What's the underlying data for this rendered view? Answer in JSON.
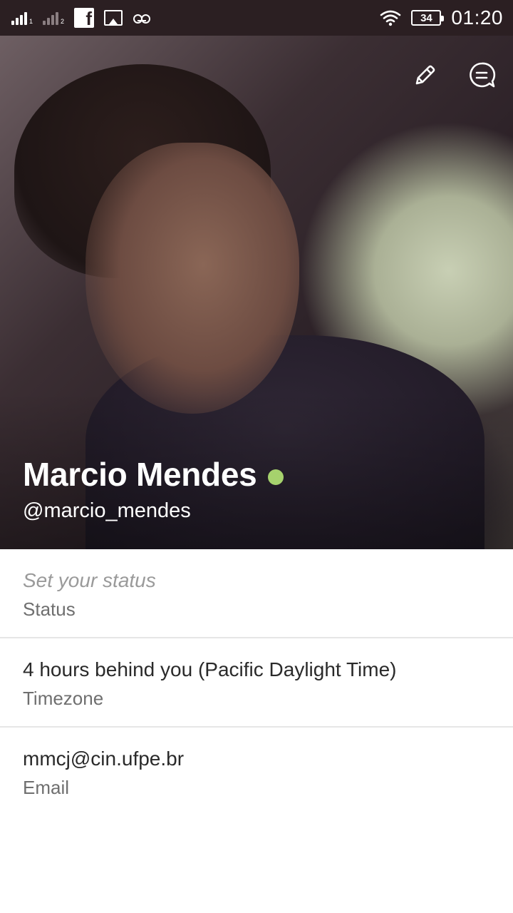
{
  "status_bar": {
    "time": "01:20",
    "battery": "34",
    "sim1_label": "1",
    "sim2_label": "2",
    "notification_icons": [
      "facebook-icon",
      "image-icon",
      "voicemail-icon"
    ],
    "facebook_glyph": "f"
  },
  "header": {
    "actions": [
      "edit-icon",
      "message-icon"
    ]
  },
  "profile": {
    "name": "Marcio Mendes",
    "handle": "@marcio_mendes",
    "presence_color": "#a6d26d"
  },
  "fields": [
    {
      "value": "Set your status",
      "label": "Status"
    },
    {
      "value": "4 hours behind you (Pacific Daylight Time)",
      "label": "Timezone"
    },
    {
      "value": "mmcj@cin.ufpe.br",
      "label": "Email"
    }
  ]
}
